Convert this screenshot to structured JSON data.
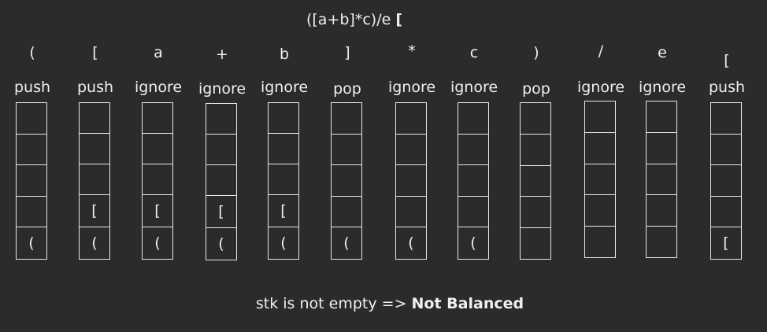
{
  "expression": {
    "text": "([a+b]*c)/e",
    "last_char": "["
  },
  "columns": [
    {
      "char": "(",
      "action": "push",
      "stack": [
        "",
        "",
        "",
        "",
        "("
      ]
    },
    {
      "char": "[",
      "action": "push",
      "stack": [
        "",
        "",
        "",
        "[",
        "("
      ]
    },
    {
      "char": "a",
      "action": "ignore",
      "stack": [
        "",
        "",
        "",
        "[",
        "("
      ]
    },
    {
      "char": "+",
      "action": "ignore",
      "stack": [
        "",
        "",
        "",
        "[",
        "("
      ]
    },
    {
      "char": "b",
      "action": "ignore",
      "stack": [
        "",
        "",
        "",
        "[",
        "("
      ]
    },
    {
      "char": "]",
      "action": "pop",
      "stack": [
        "",
        "",
        "",
        "",
        "("
      ]
    },
    {
      "char": "*",
      "action": "ignore",
      "stack": [
        "",
        "",
        "",
        "",
        "("
      ]
    },
    {
      "char": "c",
      "action": "ignore",
      "stack": [
        "",
        "",
        "",
        "",
        "("
      ]
    },
    {
      "char": ")",
      "action": "pop",
      "stack": [
        "",
        "",
        "",
        "",
        ""
      ]
    },
    {
      "char": "/",
      "action": "ignore",
      "stack": [
        "",
        "",
        "",
        "",
        ""
      ]
    },
    {
      "char": "e",
      "action": "ignore",
      "stack": [
        "",
        "",
        "",
        "",
        ""
      ]
    },
    {
      "char": "[",
      "action": "push",
      "stack": [
        "",
        "",
        "",
        "",
        "["
      ]
    }
  ],
  "result": {
    "prefix": "stk is not empty => ",
    "verdict": "Not Balanced"
  }
}
